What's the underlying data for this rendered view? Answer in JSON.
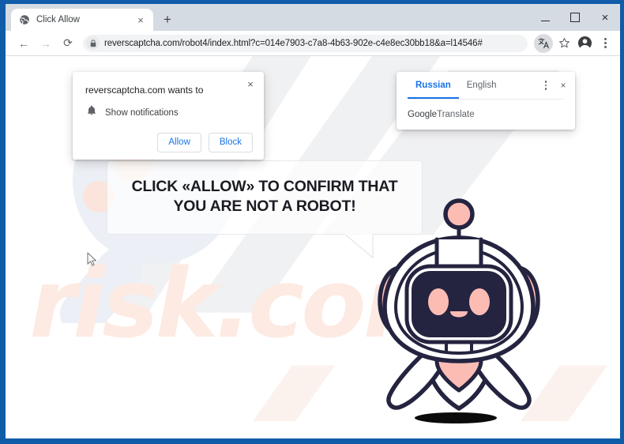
{
  "browser": {
    "tab": {
      "title": "Click Allow",
      "favicon_icon": "globe-icon",
      "close_icon": "×"
    },
    "new_tab_icon": "+",
    "window_controls": {
      "minimize_icon": "minimize-icon",
      "maximize_icon": "maximize-icon",
      "close_icon": "×"
    },
    "toolbar": {
      "back_icon": "←",
      "forward_icon": "→",
      "reload_icon": "⟳",
      "lock_icon": "lock-icon",
      "url": "reverscaptcha.com/robot4/index.html?c=014e7903-c7a8-4b63-902e-c4e8ec30bb18&a=l14546#",
      "translate_icon": "translate-icon",
      "bookmark_icon": "☆",
      "profile_icon": "profile-avatar-icon",
      "menu_icon": "three-dot-menu-icon"
    }
  },
  "permission_popup": {
    "title": "reverscaptcha.com wants to",
    "close_icon": "×",
    "permission_icon": "bell-icon",
    "permission_label": "Show notifications",
    "allow_label": "Allow",
    "block_label": "Block"
  },
  "translate_popup": {
    "tabs": [
      {
        "label": "Russian",
        "selected": true
      },
      {
        "label": "English",
        "selected": false
      }
    ],
    "menu_icon": "three-dot-menu-icon",
    "close_icon": "×",
    "footer_brand": "Google",
    "footer_text": " Translate"
  },
  "page": {
    "speech_bubble_text": "CLICK «ALLOW» TO CONFIRM THAT YOU ARE NOT A ROBOT!",
    "robot_icon": "robot-mascot-icon",
    "cursor_icon": "mouse-cursor-icon",
    "watermark_text": "risk.com",
    "watermark_magnifier_icon": "magnifier-watermark-icon"
  },
  "colors": {
    "frame_blue": "#0f5ca8",
    "tabstrip": "#d5dbe2",
    "accent_blue": "#1a73e8",
    "robot_outline": "#242440",
    "robot_pink": "#fcbcb4",
    "watermark_peach": "#fdeae2",
    "watermark_gray": "#f0f1f3",
    "watermark_blue": "#eceff5"
  }
}
